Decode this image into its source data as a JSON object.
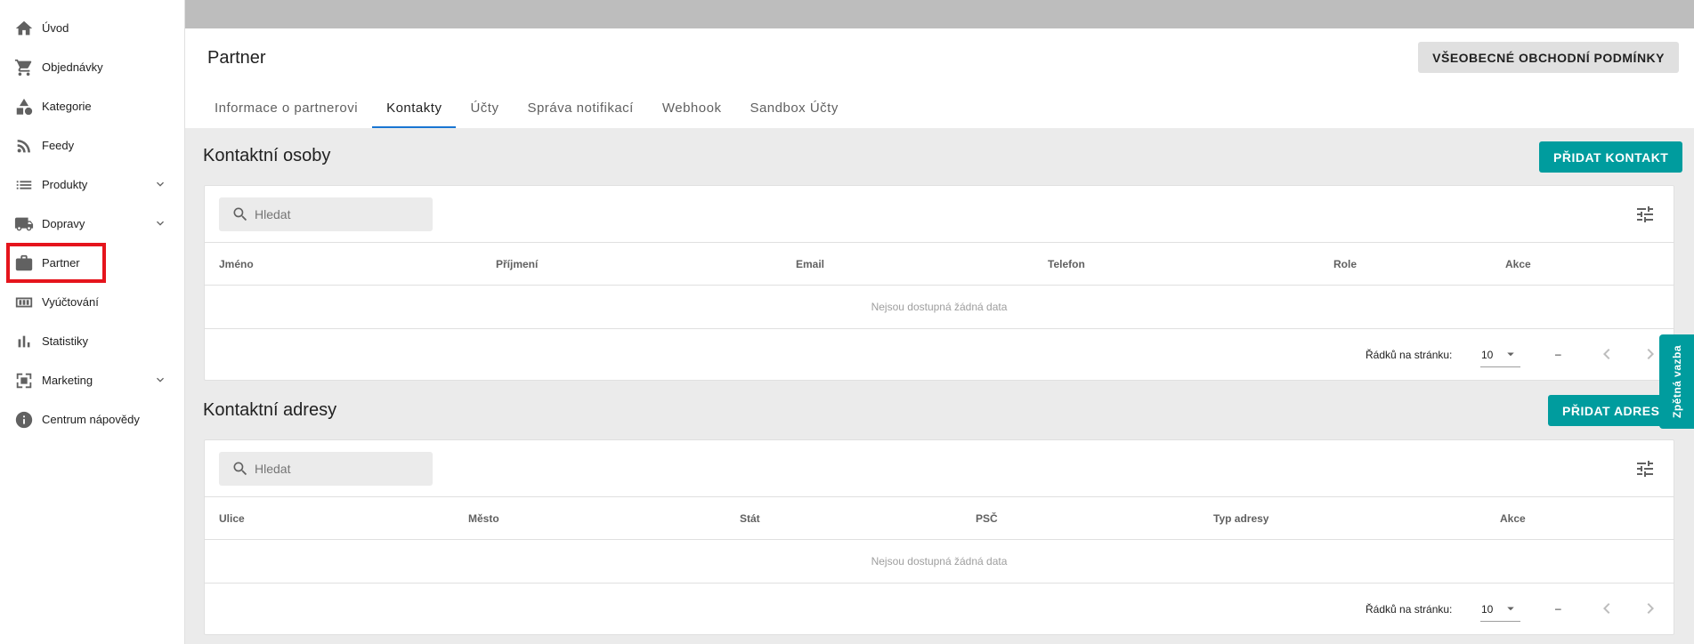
{
  "sidebar": {
    "items": [
      {
        "label": "Úvod",
        "icon": "home-icon"
      },
      {
        "label": "Objednávky",
        "icon": "cart-icon"
      },
      {
        "label": "Kategorie",
        "icon": "category-icon"
      },
      {
        "label": "Feedy",
        "icon": "rss-icon"
      },
      {
        "label": "Produkty",
        "icon": "list-icon",
        "expandable": true
      },
      {
        "label": "Dopravy",
        "icon": "truck-icon",
        "expandable": true
      },
      {
        "label": "Partner",
        "icon": "briefcase-icon",
        "highlighted": true
      },
      {
        "label": "Vyúčtování",
        "icon": "billing-icon"
      },
      {
        "label": "Statistiky",
        "icon": "bar-chart-icon"
      },
      {
        "label": "Marketing",
        "icon": "marketing-icon",
        "expandable": true
      },
      {
        "label": "Centrum nápovědy",
        "icon": "info-icon"
      }
    ]
  },
  "header": {
    "title": "Partner",
    "terms_button": "VŠEOBECNÉ OBCHODNÍ PODMÍNKY",
    "tabs": [
      {
        "label": "Informace o partnerovi",
        "active": false
      },
      {
        "label": "Kontakty",
        "active": true
      },
      {
        "label": "Účty",
        "active": false
      },
      {
        "label": "Správa notifikací",
        "active": false
      },
      {
        "label": "Webhook",
        "active": false
      },
      {
        "label": "Sandbox Účty",
        "active": false
      }
    ]
  },
  "contacts": {
    "title": "Kontaktní osoby",
    "add_button": "PŘIDAT KONTAKT",
    "search_placeholder": "Hledat",
    "columns": [
      "Jméno",
      "Příjmení",
      "Email",
      "Telefon",
      "Role",
      "Akce"
    ],
    "empty_text": "Nejsou dostupná žádná data",
    "rows_per_page_label": "Řádků na stránku:",
    "rows_per_page": "10",
    "range": "–"
  },
  "addresses": {
    "title": "Kontaktní adresy",
    "add_button": "PŘIDAT ADRESU",
    "search_placeholder": "Hledat",
    "columns": [
      "Ulice",
      "Město",
      "Stát",
      "PSČ",
      "Typ adresy",
      "Akce"
    ],
    "empty_text": "Nejsou dostupná žádná data",
    "rows_per_page_label": "Řádků na stránku:",
    "rows_per_page": "10",
    "range": "–"
  },
  "feedback": {
    "label": "Zpětná vazba"
  },
  "colors": {
    "accent": "#009c9e",
    "tab_indicator": "#1976d2",
    "highlight": "#e5141c"
  }
}
